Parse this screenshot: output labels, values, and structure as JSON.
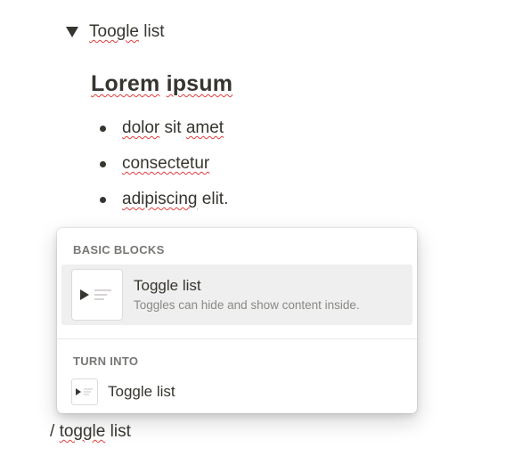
{
  "toggle": {
    "title_first": "Toogle",
    "title_rest": " list"
  },
  "heading": {
    "first": "Lorem",
    "second": "ipsum"
  },
  "bullets": [
    {
      "a": "dolor",
      "b": " sit ",
      "c": "amet"
    },
    {
      "a": "consectetur"
    },
    {
      "a": "adipiscing",
      "b": " elit."
    }
  ],
  "menu": {
    "basic_blocks_label": "BASIC BLOCKS",
    "option_title": "Toggle list",
    "option_desc": "Toggles can hide and show content inside.",
    "turn_into_label": "TURN INTO",
    "turn_into_option": "Toggle list",
    "option_icon": "toggle-list-icon"
  },
  "slash": {
    "prefix": "/ ",
    "word": "toggle",
    "rest": " list"
  }
}
